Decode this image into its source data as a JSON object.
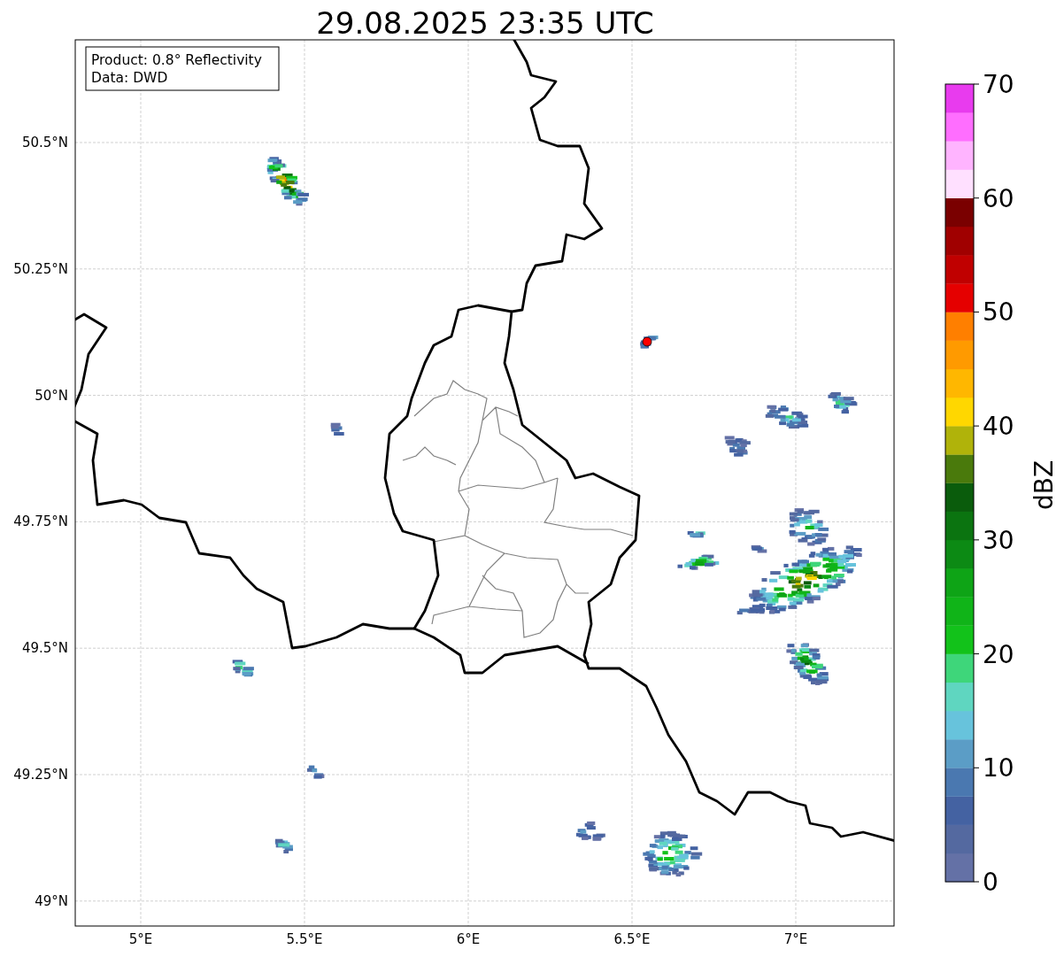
{
  "title": "29.08.2025 23:35 UTC",
  "map": {
    "info_box": [
      "Product: 0.8° Reflectivity",
      "Data: DWD"
    ],
    "x_ticks": [
      "5°E",
      "5.5°E",
      "6°E",
      "6.5°E",
      "7°E"
    ],
    "y_ticks": [
      "50.5°N",
      "50.25°N",
      "50°N",
      "49.75°N",
      "49.5°N",
      "49.25°N",
      "49°N"
    ]
  },
  "colorbar": {
    "label": "dBZ",
    "ticks": [
      "70",
      "60",
      "50",
      "40",
      "30",
      "20",
      "10",
      "0"
    ],
    "bins": [
      {
        "color": "#6471a6"
      },
      {
        "color": "#5469a0"
      },
      {
        "color": "#4462a2"
      },
      {
        "color": "#4a78b0"
      },
      {
        "color": "#5b9dc6"
      },
      {
        "color": "#67c3dc"
      },
      {
        "color": "#5fd6c0"
      },
      {
        "color": "#3ed67a"
      },
      {
        "color": "#12c21a"
      },
      {
        "color": "#10b418"
      },
      {
        "color": "#0ea416"
      },
      {
        "color": "#0c8a14"
      },
      {
        "color": "#0b7410"
      },
      {
        "color": "#0a5c0c"
      },
      {
        "color": "#4a7a0c"
      },
      {
        "color": "#b0b30a"
      },
      {
        "color": "#ffd700"
      },
      {
        "color": "#ffb700"
      },
      {
        "color": "#ff9a00"
      },
      {
        "color": "#ff7f00"
      },
      {
        "color": "#e50000"
      },
      {
        "color": "#c00000"
      },
      {
        "color": "#a00000"
      },
      {
        "color": "#7a0000"
      },
      {
        "color": "#ffe0ff"
      },
      {
        "color": "#ffb4ff"
      },
      {
        "color": "#ff6eff"
      },
      {
        "color": "#e83bee"
      }
    ]
  }
}
